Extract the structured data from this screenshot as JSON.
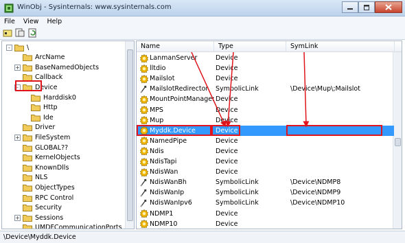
{
  "window": {
    "title": "WinObj - Sysinternals: www.sysinternals.com"
  },
  "menu": [
    "File",
    "View",
    "Help"
  ],
  "toolbar": {
    "icons": [
      "properties-icon",
      "open-folder-icon",
      "refresh-icon"
    ]
  },
  "tree": [
    {
      "label": "\\",
      "expander": "-"
    },
    {
      "label": "ArcName",
      "expander": ""
    },
    {
      "label": "BaseNamedObjects",
      "expander": "+"
    },
    {
      "label": "Callback",
      "expander": ""
    },
    {
      "label": "Device",
      "expander": "-"
    },
    {
      "label": "Harddisk0",
      "expander": ""
    },
    {
      "label": "Http",
      "expander": ""
    },
    {
      "label": "Ide",
      "expander": ""
    },
    {
      "label": "Driver",
      "expander": ""
    },
    {
      "label": "FileSystem",
      "expander": "+"
    },
    {
      "label": "GLOBAL??",
      "expander": ""
    },
    {
      "label": "KernelObjects",
      "expander": ""
    },
    {
      "label": "KnownDlls",
      "expander": ""
    },
    {
      "label": "NLS",
      "expander": ""
    },
    {
      "label": "ObjectTypes",
      "expander": ""
    },
    {
      "label": "RPC Control",
      "expander": ""
    },
    {
      "label": "Security",
      "expander": ""
    },
    {
      "label": "Sessions",
      "expander": "+"
    },
    {
      "label": "UMDFCommunicationPorts",
      "expander": ""
    }
  ],
  "columns": {
    "name": "Name",
    "type": "Type",
    "symlink": "SymLink"
  },
  "rows": [
    {
      "name": "LanmanServer",
      "type": "Device",
      "symlink": "",
      "icon": "device"
    },
    {
      "name": "lltdio",
      "type": "Device",
      "symlink": "",
      "icon": "device"
    },
    {
      "name": "Mailslot",
      "type": "Device",
      "symlink": "",
      "icon": "device"
    },
    {
      "name": "MailslotRedirector",
      "type": "SymbolicLink",
      "symlink": "\\Device\\Mup\\;Mailslot",
      "icon": "link"
    },
    {
      "name": "MountPointManager",
      "type": "Device",
      "symlink": "",
      "icon": "device"
    },
    {
      "name": "MPS",
      "type": "Device",
      "symlink": "",
      "icon": "device"
    },
    {
      "name": "Mup",
      "type": "Device",
      "symlink": "",
      "icon": "device"
    },
    {
      "name": "Myddk.Device",
      "type": "Device",
      "symlink": "",
      "icon": "device",
      "selected": true
    },
    {
      "name": "NamedPipe",
      "type": "Device",
      "symlink": "",
      "icon": "device"
    },
    {
      "name": "Ndis",
      "type": "Device",
      "symlink": "",
      "icon": "device"
    },
    {
      "name": "NdisTapi",
      "type": "Device",
      "symlink": "",
      "icon": "device"
    },
    {
      "name": "NdisWan",
      "type": "Device",
      "symlink": "",
      "icon": "device"
    },
    {
      "name": "NdisWanBh",
      "type": "SymbolicLink",
      "symlink": "\\Device\\NDMP8",
      "icon": "link"
    },
    {
      "name": "NdisWanIp",
      "type": "SymbolicLink",
      "symlink": "\\Device\\NDMP9",
      "icon": "link"
    },
    {
      "name": "NdisWanIpv6",
      "type": "SymbolicLink",
      "symlink": "\\Device\\NDMP10",
      "icon": "link"
    },
    {
      "name": "NDMP1",
      "type": "Device",
      "symlink": "",
      "icon": "device"
    },
    {
      "name": "NDMP10",
      "type": "Device",
      "symlink": "",
      "icon": "device"
    }
  ],
  "status": "\\Device\\Myddk.Device",
  "colors": {
    "selection": "#3399ff",
    "annotation": "#e0141c",
    "folder": "#f2cc5a",
    "device_icon": "#f0b400"
  }
}
